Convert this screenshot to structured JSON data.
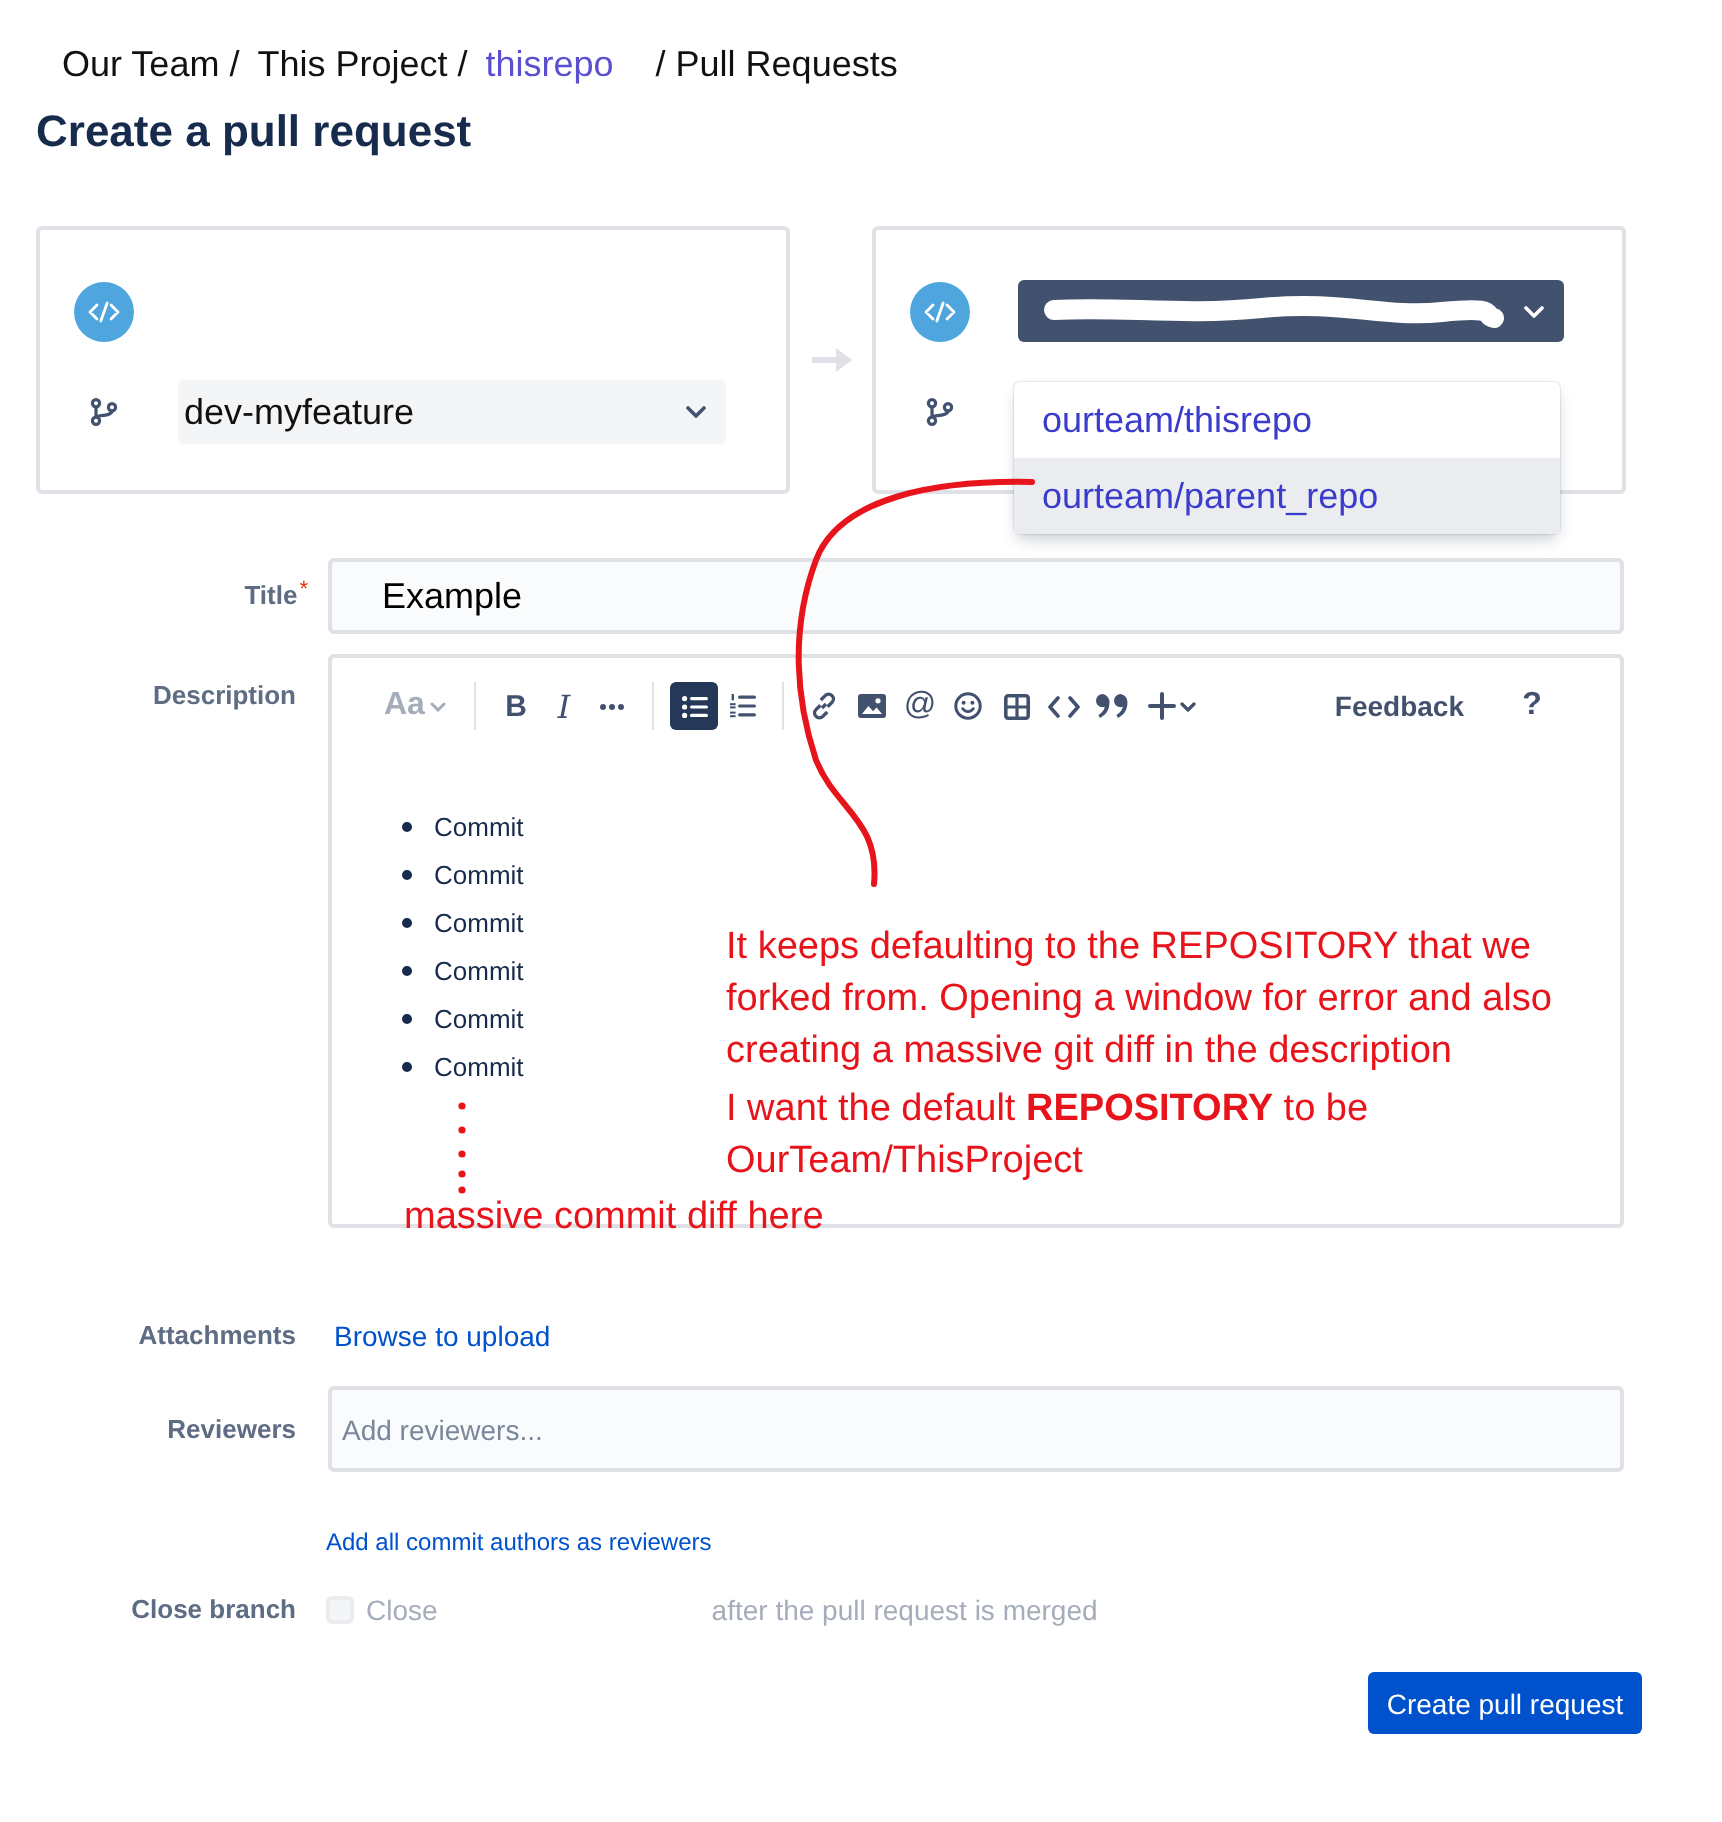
{
  "breadcrumb": [
    {
      "text": "Our Team /",
      "kind": "text"
    },
    {
      "text": "This Project /",
      "kind": "text"
    },
    {
      "text": "thisrepo",
      "kind": "link"
    },
    {
      "text": "/ Pull Requests",
      "kind": "text"
    }
  ],
  "page_title": "Create a pull request",
  "source": {
    "branch_select": {
      "value": "dev-myfeature"
    }
  },
  "destination": {
    "repository_select": {
      "expanded": true,
      "options": [
        {
          "label": "ourteam/thisrepo",
          "selected": false
        },
        {
          "label": "ourteam/parent_repo",
          "selected": true
        }
      ]
    }
  },
  "form": {
    "title": {
      "label": "Title",
      "required_mark": "*",
      "value": "Example"
    },
    "description": {
      "label": "Description",
      "toolbar_groups": [
        {
          "items": [
            {
              "kind": "text-style",
              "label": "Aa",
              "selected": false,
              "disabled": true
            }
          ]
        },
        {
          "items": [
            {
              "kind": "bold",
              "label": "B",
              "selected": false,
              "disabled": false
            },
            {
              "kind": "italic",
              "label": "I",
              "selected": false,
              "disabled": false
            },
            {
              "kind": "more",
              "selected": false,
              "disabled": false
            }
          ]
        },
        {
          "items": [
            {
              "kind": "bullet-list",
              "selected": true,
              "disabled": false
            },
            {
              "kind": "numbered-list",
              "selected": false,
              "disabled": false
            }
          ]
        },
        {
          "items": [
            {
              "kind": "link",
              "selected": false,
              "disabled": false
            },
            {
              "kind": "image",
              "selected": false,
              "disabled": false
            },
            {
              "kind": "mention",
              "label": "@",
              "selected": false,
              "disabled": false
            },
            {
              "kind": "emoji",
              "selected": false,
              "disabled": false
            },
            {
              "kind": "table",
              "selected": false,
              "disabled": false
            },
            {
              "kind": "code",
              "selected": false,
              "disabled": false
            },
            {
              "kind": "quote",
              "selected": false,
              "disabled": false
            },
            {
              "kind": "insert",
              "selected": false,
              "disabled": false
            }
          ]
        }
      ],
      "feedback": "Feedback",
      "help": "?",
      "bullets": [
        "Commit",
        "Commit",
        "Commit",
        "Commit",
        "Commit",
        "Commit"
      ]
    },
    "attachments": {
      "label": "Attachments",
      "link": "Browse to upload"
    },
    "reviewers": {
      "label": "Reviewers",
      "placeholder": "Add reviewers...",
      "link": "Add all commit authors as reviewers"
    },
    "close_branch": {
      "label": "Close branch",
      "option": "Close",
      "checked": false,
      "disabled": true,
      "suffix": "after the pull request is merged"
    }
  },
  "submit_button": "Create pull request",
  "annotations": {
    "notes": [
      "It keeps defaulting to the REPOSITORY that we forked from. Opening a window for error and also creating a massive git diff in the description",
      "I want the default **REPOSITORY** to be OurTeam/ThisProject"
    ],
    "caption": "massive commit diff here"
  }
}
